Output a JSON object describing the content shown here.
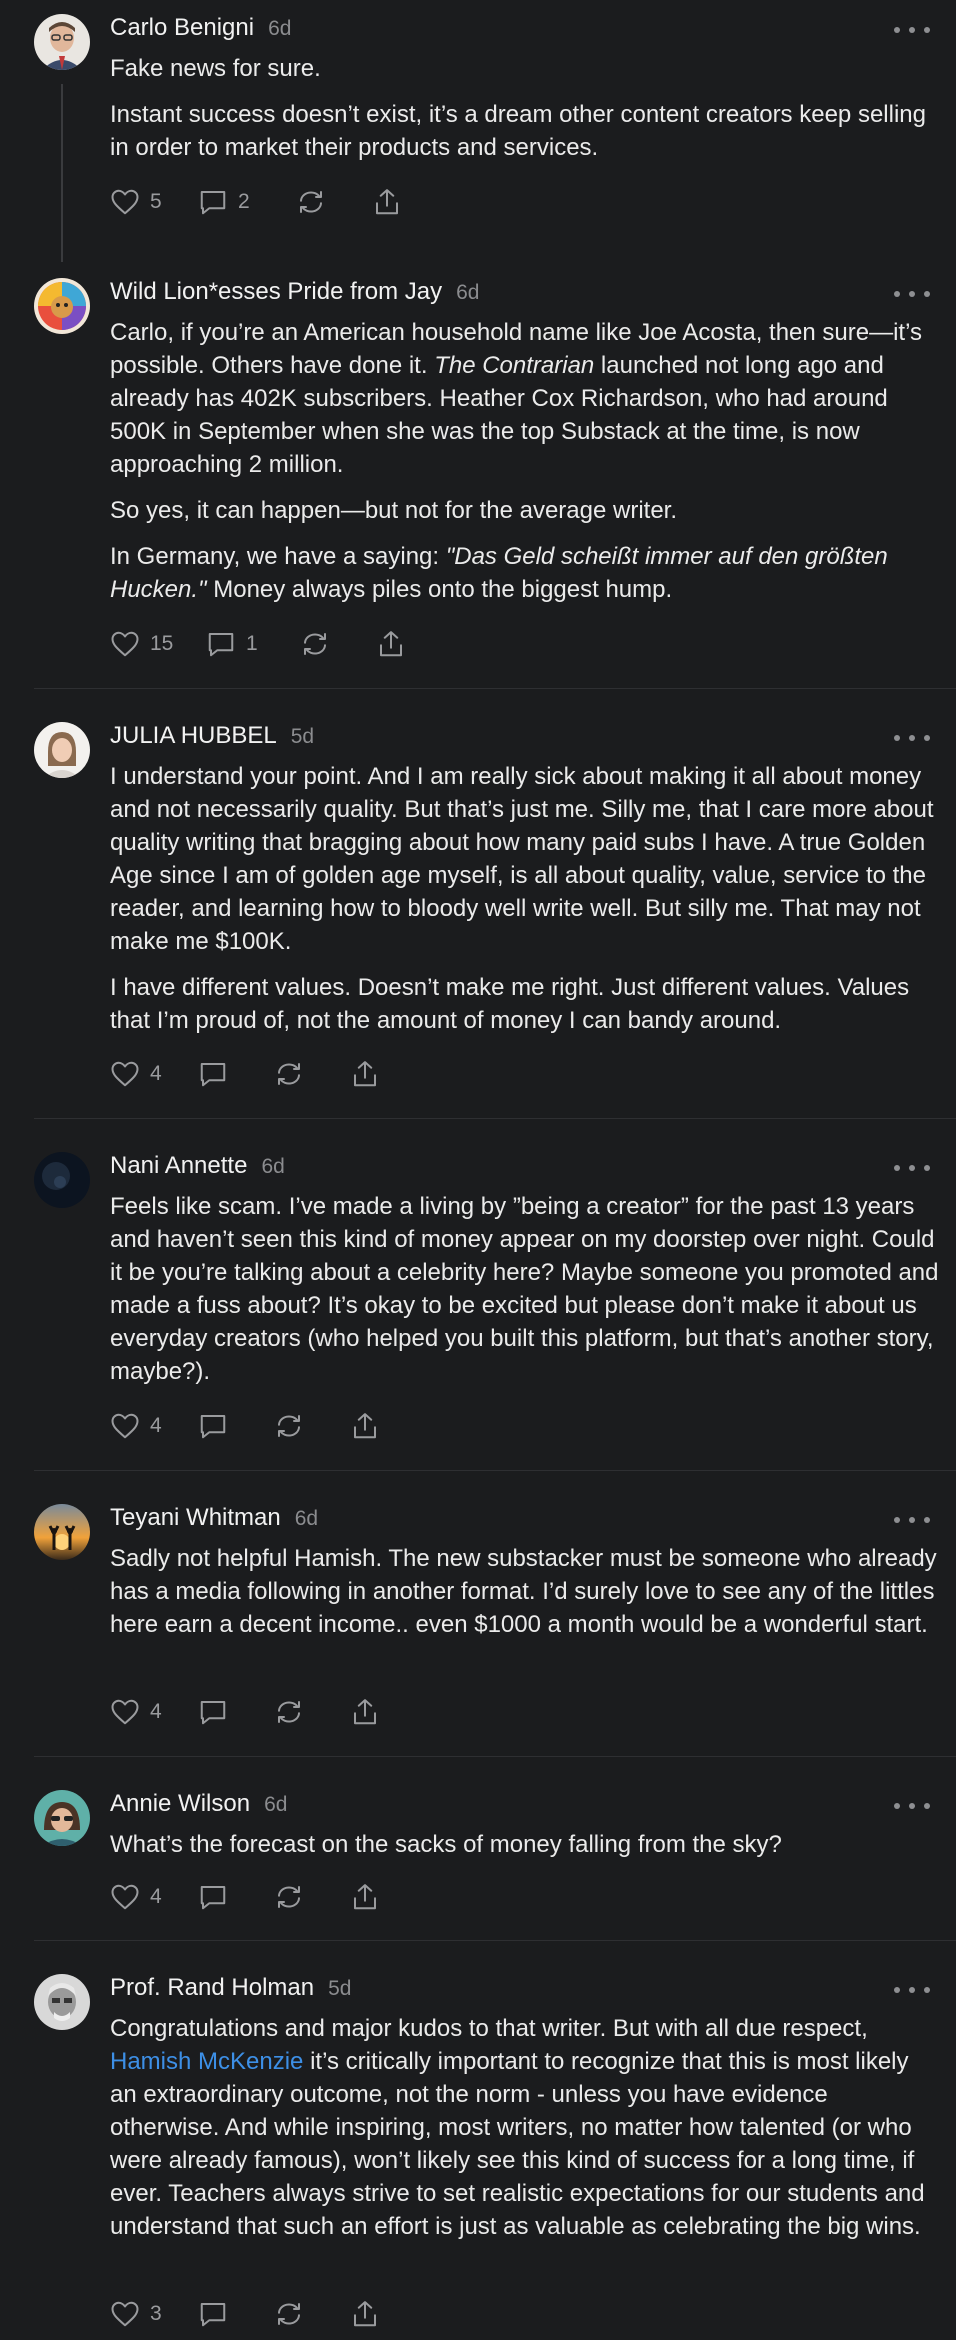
{
  "comments": [
    {
      "author": "Carlo Benigni",
      "time": "6d",
      "paragraphs": [
        "Fake news for sure.",
        "Instant success doesn’t exist, it’s a dream other content creators keep selling in order to market their products and services."
      ],
      "likes": "5",
      "replies": "2"
    },
    {
      "author": "Wild Lion*esses Pride from Jay",
      "time": "6d",
      "p1_a": "Carlo, if you’re an American household name like Joe Acosta, then sure—it’s possible. Others have done it. ",
      "p1_em": "The Contrarian",
      "p1_b": " launched not long ago and already has 402K subscribers. Heather Cox Richardson, who had around 500K in September when she was the top Substack at the time, is now approaching 2 million.",
      "p2": "So yes, it can happen—but not for the average writer.",
      "p3_a": "In Germany, we have a saying: ",
      "p3_em": "\"Das Geld scheißt immer auf den größten Hucken.\"",
      "p3_b": " Money always piles onto the biggest hump.",
      "likes": "15",
      "replies": "1"
    },
    {
      "author": "JULIA HUBBEL",
      "time": "5d",
      "paragraphs": [
        "I understand your point. And I am really sick about making it all about money and not necessarily quality. But that’s just me. Silly me, that I care more about quality writing that bragging about how many paid subs I have. A true Golden Age since I am of golden age myself, is all about quality, value, service to the reader, and learning how to bloody well write well. But silly me. That may not make me $100K.",
        "I have different values. Doesn’t make me right. Just different values. Values that I’m proud of, not the amount of money I can bandy around."
      ],
      "likes": "4"
    },
    {
      "author": "Nani Annette",
      "time": "6d",
      "paragraphs": [
        "Feels like scam. I’ve made a living by ”being a creator” for the past 13 years and haven’t seen this kind of money appear on my doorstep over night. Could it be you’re talking about a celebrity here? Maybe someone you promoted and made a fuss about? It’s okay to be excited but please don’t make it about us everyday creators (who helped you built this platform, but that’s another story, maybe?)."
      ],
      "likes": "4"
    },
    {
      "author": "Teyani Whitman",
      "time": "6d",
      "paragraphs": [
        "Sadly not helpful Hamish. The new substacker must be someone who already has a media following in another format. I’d surely love to see any of the littles here earn a decent income.. even $1000 a month would be a wonderful start."
      ],
      "likes": "4"
    },
    {
      "author": "Annie Wilson",
      "time": "6d",
      "paragraphs": [
        "What’s the forecast on the sacks of money falling from the sky?"
      ],
      "likes": "4"
    },
    {
      "author": "Prof. Rand Holman",
      "time": "5d",
      "p1_a": "Congratulations and major kudos to that writer. But with all due respect, ",
      "p1_link": "Hamish McKenzie",
      "p1_b": " it’s critically important to recognize that this is most likely an extraordinary outcome, not the norm - unless you have evidence otherwise. And while inspiring, most writers, no matter how talented (or who were already famous), won’t likely see this kind of success for a long time, if ever. Teachers always strive to set realistic expectations for our students and understand that such an effort is just as valuable as celebrating the big wins.",
      "likes": "3"
    }
  ]
}
